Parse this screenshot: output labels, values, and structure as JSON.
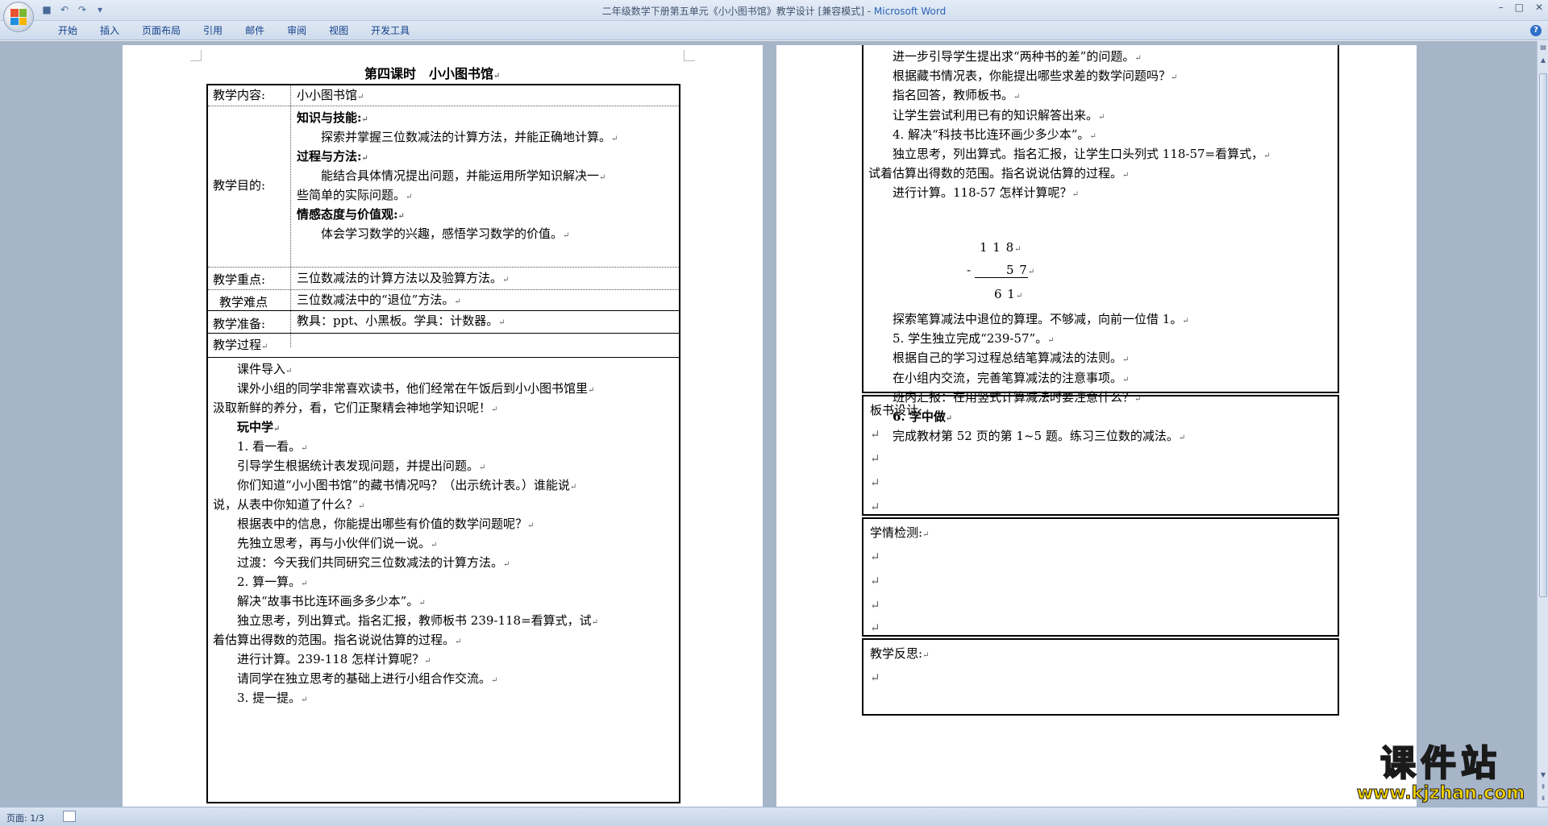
{
  "window": {
    "title_prefix": "二年级数学下册第五单元《小小图书馆》教学设计 [兼容模式] - ",
    "app_name": "Microsoft Word",
    "minimize": "–",
    "maximize": "□",
    "close": "✕"
  },
  "ribbon": {
    "tabs": [
      "开始",
      "插入",
      "页面布局",
      "引用",
      "邮件",
      "审阅",
      "视图",
      "开发工具"
    ],
    "help": "?"
  },
  "status": {
    "page": "页面: 1/3"
  },
  "left_page": {
    "heading": "第四课时　小小图书馆",
    "rows": {
      "content_label": "教学内容:",
      "content_value": "小小图书馆",
      "goal_label": "教学目的:",
      "goal_lines": [
        {
          "text": "知识与技能:",
          "bold": true,
          "indent": false
        },
        {
          "text": "探索并掌握三位数减法的计算方法，并能正确地计算。",
          "bold": false,
          "indent": true
        },
        {
          "text": "过程与方法:",
          "bold": true,
          "indent": false
        },
        {
          "text": "能结合具体情况提出问题，并能运用所学知识解决一",
          "bold": false,
          "indent": true
        },
        {
          "text": "些简单的实际问题。",
          "bold": false,
          "indent": false
        },
        {
          "text": "情感态度与价值观:",
          "bold": true,
          "indent": false
        },
        {
          "text": "体会学习数学的兴趣，感悟学习数学的价值。",
          "bold": false,
          "indent": true
        }
      ],
      "key_label": "教学重点:",
      "key_value": "三位数减法的计算方法以及验算方法。",
      "diff_label": "教学难点",
      "diff_value": "三位数减法中的“退位”方法。",
      "prep_label": "教学准备:",
      "prep_value": "教具：ppt、小黑板。学具：计数器。",
      "process_label": "教学过程"
    },
    "process_lines": [
      {
        "text": "课件导入",
        "bold": false,
        "indent": true
      },
      {
        "text": "课外小组的同学非常喜欢读书，他们经常在午饭后到小小图书馆里",
        "bold": false,
        "indent": true
      },
      {
        "text": "汲取新鲜的养分，看，它们正聚精会神地学知识呢！",
        "bold": false,
        "indent": false
      },
      {
        "text": "玩中学",
        "bold": true,
        "indent": true
      },
      {
        "text": "1. 看一看。",
        "bold": false,
        "indent": true
      },
      {
        "text": "引导学生根据统计表发现问题，并提出问题。",
        "bold": false,
        "indent": true
      },
      {
        "text": "你们知道“小小图书馆”的藏书情况吗？（出示统计表。）谁能说",
        "bold": false,
        "indent": true
      },
      {
        "text": "说，从表中你知道了什么？",
        "bold": false,
        "indent": false
      },
      {
        "text": "根据表中的信息，你能提出哪些有价值的数学问题呢？",
        "bold": false,
        "indent": true
      },
      {
        "text": "先独立思考，再与小伙伴们说一说。",
        "bold": false,
        "indent": true
      },
      {
        "text": "过渡：今天我们共同研究三位数减法的计算方法。",
        "bold": false,
        "indent": true
      },
      {
        "text": "2. 算一算。",
        "bold": false,
        "indent": true
      },
      {
        "text": "解决“故事书比连环画多多少本”。",
        "bold": false,
        "indent": true
      },
      {
        "text": "独立思考，列出算式。指名汇报，教师板书 239-118=看算式，试",
        "bold": false,
        "indent": true
      },
      {
        "text": "着估算出得数的范围。指名说说估算的过程。",
        "bold": false,
        "indent": false
      },
      {
        "text": "进行计算。239-118 怎样计算呢？",
        "bold": false,
        "indent": true
      },
      {
        "text": "请同学在独立思考的基础上进行小组合作交流。",
        "bold": false,
        "indent": true
      },
      {
        "text": "3. 提一提。",
        "bold": false,
        "indent": true
      }
    ]
  },
  "right_page": {
    "lines": [
      {
        "text": "进一步引导学生提出求“两种书的差”的问题。",
        "bold": false,
        "indent": true
      },
      {
        "text": "根据藏书情况表，你能提出哪些求差的数学问题吗？",
        "bold": false,
        "indent": true
      },
      {
        "text": "指名回答，教师板书。",
        "bold": false,
        "indent": true
      },
      {
        "text": "让学生尝试利用已有的知识解答出来。",
        "bold": false,
        "indent": true
      },
      {
        "text": "4. 解决“科技书比连环画少多少本”。",
        "bold": false,
        "indent": true
      },
      {
        "text": "独立思考，列出算式。指名汇报，让学生口头列式 118-57=看算式，",
        "bold": false,
        "indent": true
      },
      {
        "text": "试着估算出得数的范围。指名说说估算的过程。",
        "bold": false,
        "indent": false
      },
      {
        "text": "进行计算。118-57 怎样计算呢？",
        "bold": false,
        "indent": true
      }
    ],
    "calc": {
      "top": "1 1 8",
      "minus": "-",
      "sub": "5 7",
      "result": "6 1"
    },
    "lines2": [
      {
        "text": "探索笔算减法中退位的算理。不够减，向前一位借 1。",
        "bold": false,
        "indent": true
      },
      {
        "text": "5. 学生独立完成“239-57”。",
        "bold": false,
        "indent": true
      },
      {
        "text": "根据自己的学习过程总结笔算减法的法则。",
        "bold": false,
        "indent": true
      },
      {
        "text": "在小组内交流，完善笔算减法的注意事项。",
        "bold": false,
        "indent": true
      },
      {
        "text": "班内汇报：在用竖式计算减法时要注意什么？",
        "bold": false,
        "indent": true
      },
      {
        "text": "6. 学中做",
        "bold": true,
        "indent": true
      },
      {
        "text": "完成教材第 52 页的第 1~5 题。练习三位数的减法。",
        "bold": false,
        "indent": true
      }
    ],
    "board_label": "板书设计:",
    "check_label": "学情检测:",
    "reflect_label": "教学反思:"
  },
  "watermark": {
    "main": "课件站",
    "url": "www.kjzhan.com"
  },
  "para_mark": "↵"
}
